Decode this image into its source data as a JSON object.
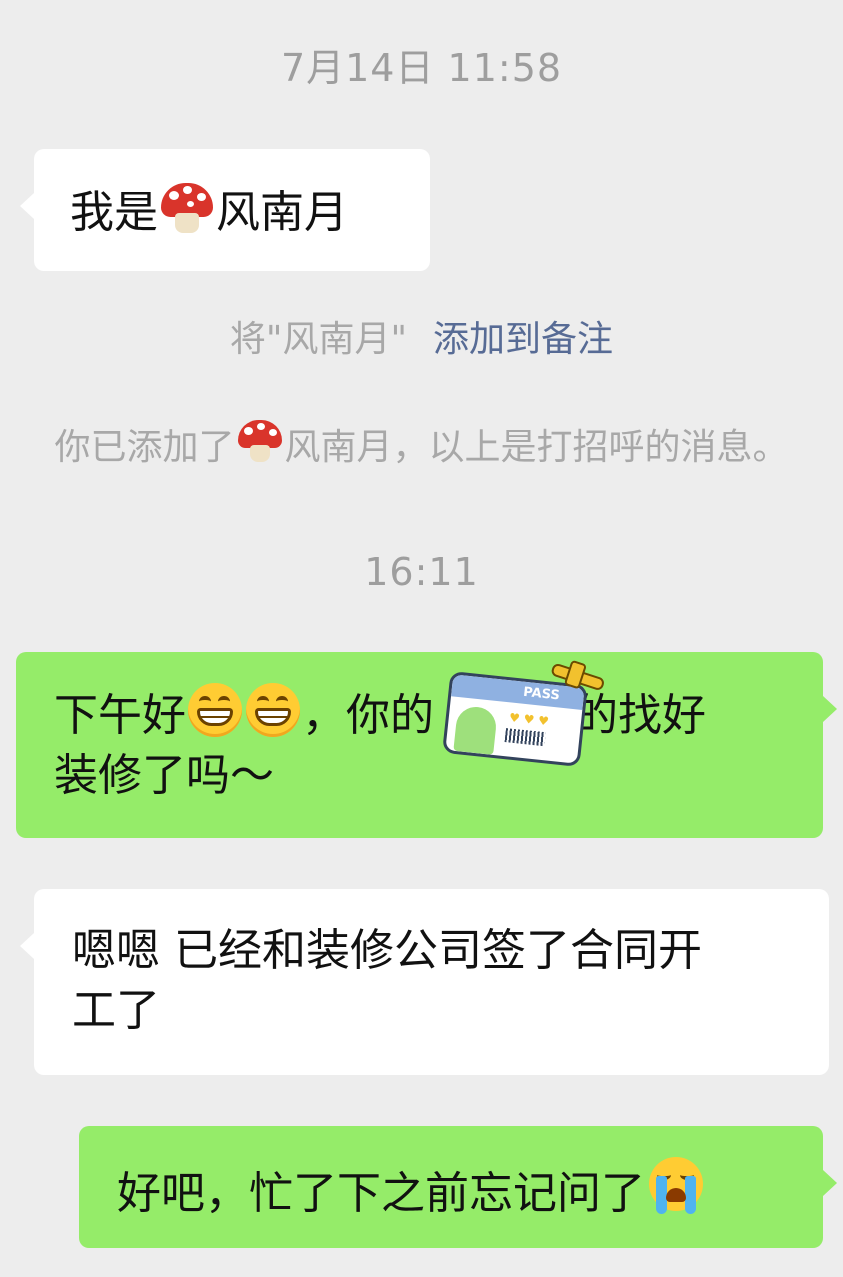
{
  "timestamps": {
    "first": "7月14日 11:58",
    "second": "16:11"
  },
  "messages": {
    "m1": {
      "before": "我是",
      "emoji": "mushroom",
      "after": "风南月"
    },
    "m2": {
      "line1_before": "下午好",
      "emojis": [
        "grinning-face",
        "grinning-face"
      ],
      "line1_after": "，你的",
      "line1_tail": "城的找好",
      "line2": "装修了吗～",
      "sticker": "boarding-pass-sticker"
    },
    "m3": {
      "line1": "嗯嗯 已经和装修公司签了合同开",
      "line2": "工了"
    },
    "m4": {
      "text": "好吧，忙了下之前忘记问了",
      "emoji": "crying-face"
    }
  },
  "system": {
    "remark_prefix": "将\"风南月\"",
    "remark_link": "添加到备注",
    "added_before": "你已添加了",
    "added_emoji": "mushroom",
    "added_after": "风南月，以上是打招呼的消息。"
  },
  "sticker": {
    "label": "PASS"
  },
  "colors": {
    "background": "#ededed",
    "sent_bubble": "#95ec69",
    "received_bubble": "#ffffff",
    "system_text": "#a8a8a8",
    "link": "#576b95"
  }
}
